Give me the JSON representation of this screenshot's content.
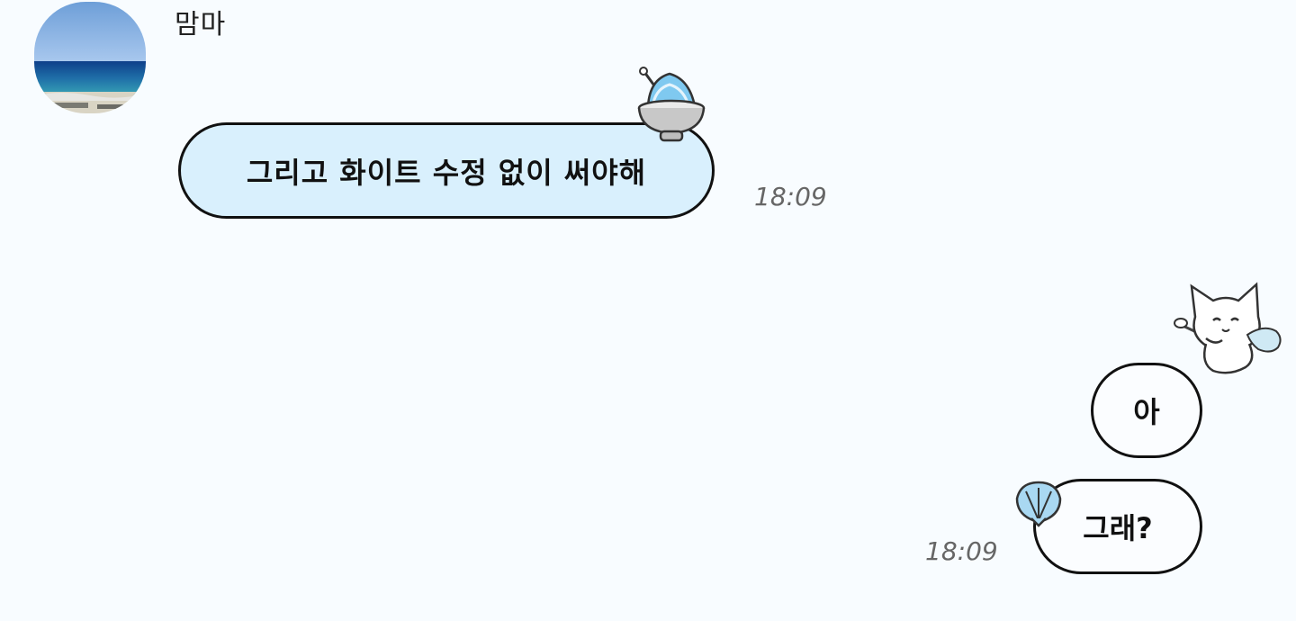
{
  "chat": {
    "sender": {
      "name": "맘마",
      "avatar_icon": "beach-sea-photo"
    },
    "messages": [
      {
        "direction": "incoming",
        "text": "그리고 화이트 수정 없이 써야해",
        "time": "18:09",
        "decoration_icon": "shaved-ice-bowl-icon"
      },
      {
        "direction": "outgoing",
        "text": "아",
        "decoration_icon": "white-cat-sticker-icon"
      },
      {
        "direction": "outgoing",
        "text": "그래?",
        "time": "18:09",
        "decoration_icon": "seashell-icon"
      }
    ]
  },
  "colors": {
    "background": "#f8fcff",
    "incoming_bubble": "#d9f0fd",
    "outgoing_bubble": "#fbfdff",
    "border": "#111111",
    "timestamp": "#666666"
  }
}
